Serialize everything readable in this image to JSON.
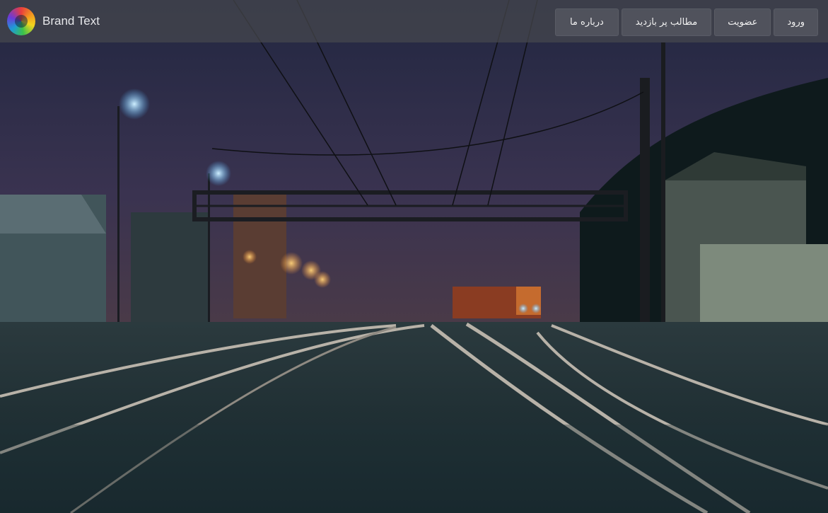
{
  "navbar": {
    "brand": {
      "text": "Brand Text",
      "logo_icon": "camera-aperture-logo-icon"
    },
    "menu": [
      {
        "label": "ورود"
      },
      {
        "label": "عضویت"
      },
      {
        "label": "مطالب پر بازدید"
      },
      {
        "label": "درباره ما"
      }
    ]
  }
}
